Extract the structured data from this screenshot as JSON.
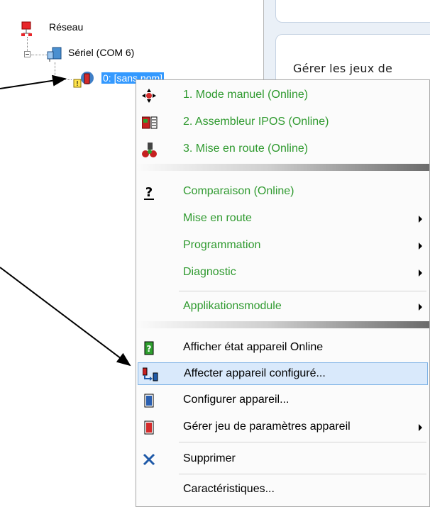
{
  "tree": {
    "root_label": "Réseau",
    "serial_label": "Sériel (COM 6)",
    "device_label": "0: [sans nom]"
  },
  "right_panel": {
    "card_text": "Gérer les jeux de"
  },
  "context_menu": {
    "items": [
      {
        "label": "1. Mode manuel (Online)",
        "icon": "move-arrows-icon"
      },
      {
        "label": "2. Assembleur IPOS (Online)",
        "icon": "ipos-assembler-icon"
      },
      {
        "label": "3. Mise en route (Online)",
        "icon": "startup-icon"
      },
      {
        "label": "Comparaison (Online)",
        "icon": "question-icon"
      },
      {
        "label": "Mise en route"
      },
      {
        "label": "Programmation"
      },
      {
        "label": "Diagnostic"
      },
      {
        "label": "Applikationsmodule"
      },
      {
        "label": "Afficher état appareil Online",
        "icon": "device-status-icon"
      },
      {
        "label": "Affecter appareil configuré...",
        "icon": "assign-device-icon"
      },
      {
        "label": "Configurer appareil...",
        "icon": "configure-device-icon"
      },
      {
        "label": "Gérer jeu de paramètres appareil",
        "icon": "parameter-set-icon"
      },
      {
        "label": "Supprimer",
        "icon": "delete-x-icon"
      },
      {
        "label": "Caractéristiques..."
      }
    ],
    "highlighted_index": 9,
    "colors": {
      "online_text": "#2f9a2f",
      "highlight_bg": "#d9e9fb",
      "selection": "#3399ff"
    }
  }
}
